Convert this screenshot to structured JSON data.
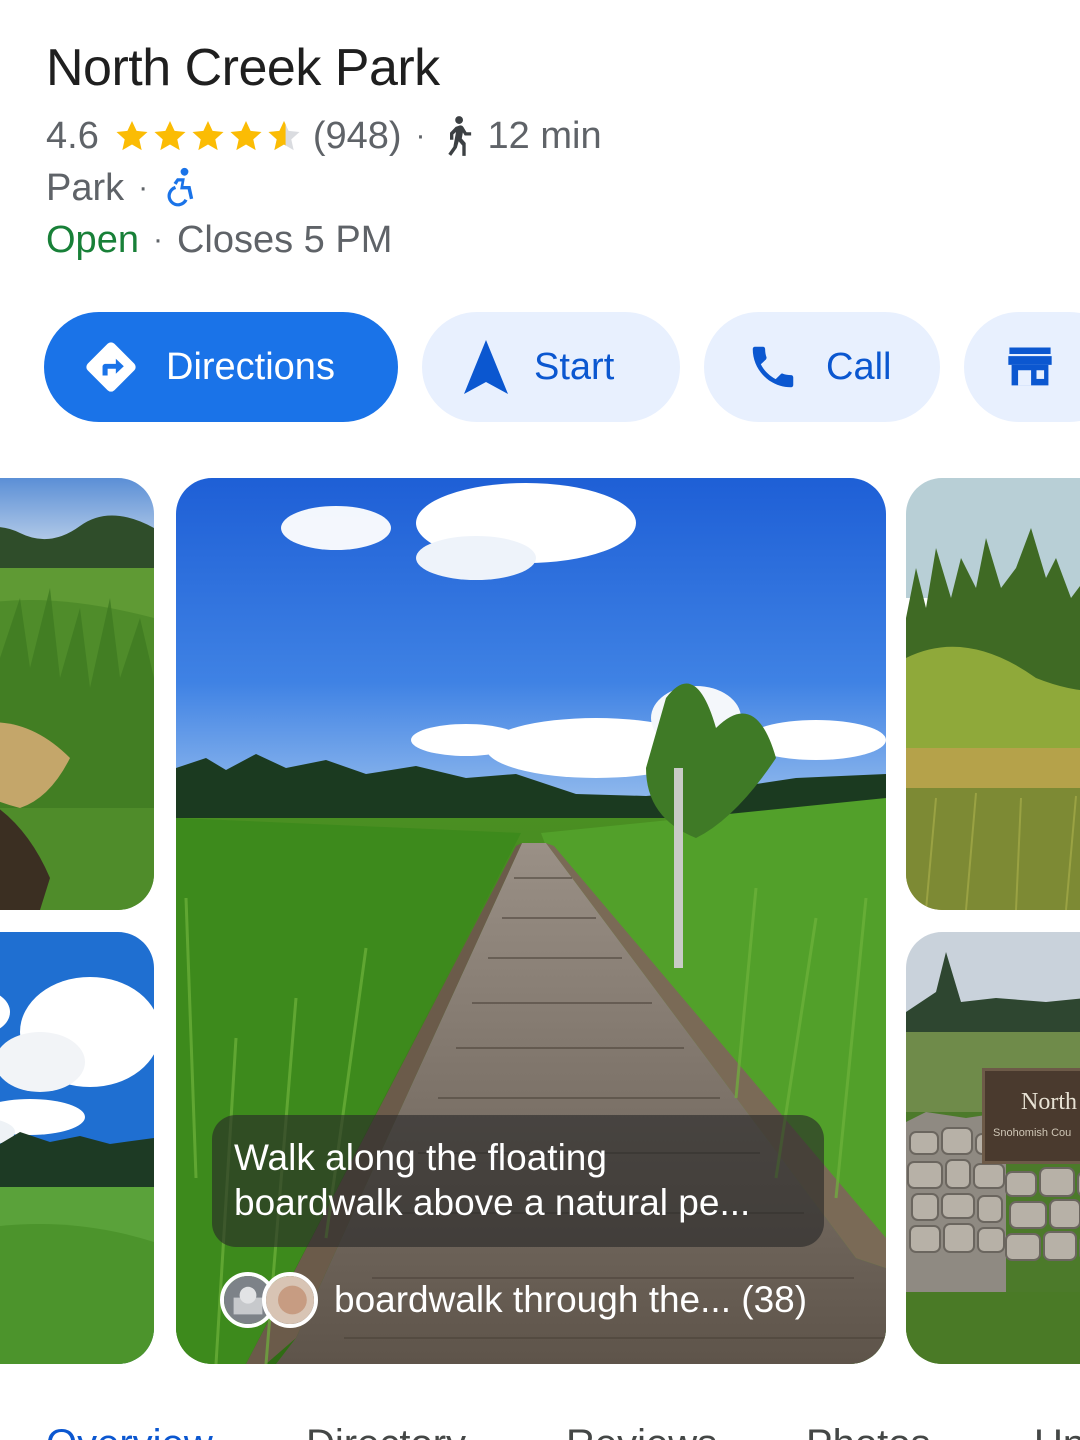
{
  "place": {
    "name": "North Creek Park",
    "rating": "4.6",
    "rating_value": 4.6,
    "reviews": "(948)",
    "walk_time": "12 min",
    "category": "Park",
    "status": "Open",
    "closes": "Closes 5 PM"
  },
  "actions": {
    "directions": "Directions",
    "start": "Start",
    "call": "Call"
  },
  "gallery": {
    "caption_line1": "Walk along the floating",
    "caption_line2": "boardwalk above a natural pe...",
    "album_title": "boardwalk through the... (38)",
    "sign_title": "North",
    "sign_subtitle": "Snohomish Cou"
  },
  "tabs": [
    {
      "label": "Overview"
    },
    {
      "label": "Directory"
    },
    {
      "label": "Reviews"
    },
    {
      "label": "Photos"
    },
    {
      "label": "Updates"
    }
  ],
  "colors": {
    "primary": "#1a73e8",
    "chip_bg": "#e8f0fe",
    "chip_text": "#0b57d0",
    "open": "#188038",
    "star": "#fbbc04",
    "meta_text": "#5f6368"
  },
  "icons": {
    "directions": "directions-diamond-icon",
    "start": "navigation-arrow-icon",
    "call": "phone-icon",
    "more": "storefront-icon",
    "walk": "walking-person-icon",
    "accessibility": "wheelchair-accessible-icon"
  }
}
